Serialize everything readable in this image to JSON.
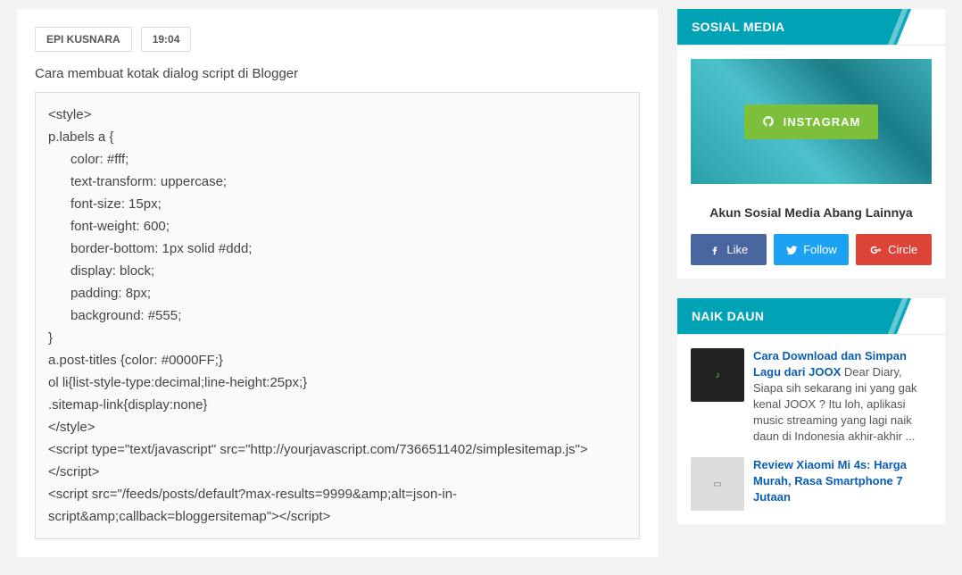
{
  "post": {
    "author": "EPI KUSNARA",
    "time": "19:04",
    "intro": "Cara membuat kotak dialog script di Blogger",
    "code": "<style>\np.labels a {\n      color: #fff;\n      text-transform: uppercase;\n      font-size: 15px;\n      font-weight: 600;\n      border-bottom: 1px solid #ddd;\n      display: block;\n      padding: 8px;\n      background: #555;\n}\na.post-titles {color: #0000FF;}\nol li{list-style-type:decimal;line-height:25px;}\n.sitemap-link{display:none}\n</style>\n<script type=\"text/javascript\" src=\"http://yourjavascript.com/7366511402/simplesitemap.js\"></script>\n<script src=\"/feeds/posts/default?max-results=9999&amp;alt=json-in-script&amp;callback=bloggersitemap\"></script>"
  },
  "sidebar": {
    "social": {
      "heading": "SOSIAL MEDIA",
      "instagram_label": "INSTAGRAM",
      "caption": "Akun Sosial Media Abang Lainnya",
      "fb_label": "Like",
      "tw_label": "Follow",
      "gp_label": "Circle"
    },
    "popular": {
      "heading": "NAIK DAUN",
      "items": [
        {
          "title": "Cara Download dan Simpan Lagu dari JOOX",
          "excerpt": "Dear Diary, Siapa sih sekarang ini yang gak kenal  JOOX ? Itu loh, aplikasi music streaming yang lagi naik daun di Indonesia akhir-akhir ..."
        },
        {
          "title": "Review Xiaomi Mi 4s: Harga Murah, Rasa Smartphone 7 Jutaan",
          "excerpt": ""
        }
      ]
    }
  }
}
